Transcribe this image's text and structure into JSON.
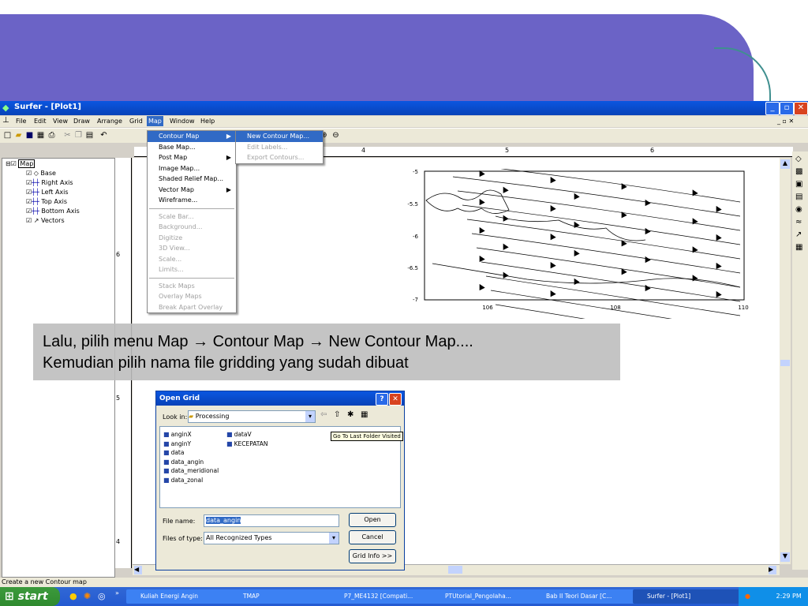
{
  "window": {
    "title": "Surfer - [Plot1]"
  },
  "menubar": [
    "File",
    "Edit",
    "View",
    "Draw",
    "Arrange",
    "Grid",
    "Map",
    "Window",
    "Help"
  ],
  "map_menu": {
    "items": [
      {
        "label": "Contour Map",
        "state": "selected",
        "submenu": true
      },
      {
        "label": "Base Map...",
        "state": "enabled"
      },
      {
        "label": "Post Map",
        "state": "enabled",
        "submenu": true
      },
      {
        "label": "Image Map...",
        "state": "enabled"
      },
      {
        "label": "Shaded Relief Map...",
        "state": "enabled"
      },
      {
        "label": "Vector Map",
        "state": "enabled",
        "submenu": true
      },
      {
        "label": "Wireframe...",
        "state": "enabled"
      },
      {
        "label": "Scale Bar...",
        "state": "disabled"
      },
      {
        "label": "Background...",
        "state": "disabled"
      },
      {
        "label": "Digitize",
        "state": "disabled"
      },
      {
        "label": "3D View...",
        "state": "disabled"
      },
      {
        "label": "Scale...",
        "state": "disabled"
      },
      {
        "label": "Limits...",
        "state": "disabled"
      },
      {
        "label": "Stack Maps",
        "state": "disabled"
      },
      {
        "label": "Overlay Maps",
        "state": "disabled"
      },
      {
        "label": "Break Apart Overlay",
        "state": "disabled"
      }
    ]
  },
  "contour_submenu": [
    "New Contour Map...",
    "Edit Labels...",
    "Export Contours..."
  ],
  "tree": {
    "root": "Map",
    "children": [
      "Base",
      "Right Axis",
      "Left Axis",
      "Top Axis",
      "Bottom Axis",
      "Vectors"
    ]
  },
  "ruler": {
    "top": [
      "4",
      "5",
      "6"
    ],
    "left": [
      "6",
      "5",
      "4"
    ]
  },
  "plot": {
    "y_ticks": [
      "-5",
      "-5.5",
      "-6",
      "-6.5",
      "-7"
    ],
    "x_ticks": [
      "106",
      "108",
      "110"
    ]
  },
  "caption": {
    "line1": "Lalu, pilih menu Map → Contour Map → New Contour Map....",
    "line2": "Kemudian pilih nama file gridding yang sudah dibuat"
  },
  "dialog": {
    "title": "Open Grid",
    "look_in_label": "Look in:",
    "look_in_value": "Processing",
    "tooltip": "Go To Last Folder Visited",
    "files_col1": [
      "anginX",
      "anginY",
      "data",
      "data_angin",
      "data_meridional",
      "data_zonal"
    ],
    "files_col2": [
      "dataV",
      "KECEPATAN"
    ],
    "file_name_label": "File name:",
    "file_name_value": "data_angin",
    "file_type_label": "Files of type:",
    "file_type_value": "All Recognized Types",
    "open_label": "Open",
    "cancel_label": "Cancel",
    "gridinfo_label": "Grid Info >>"
  },
  "status": "Create a new Contour map",
  "taskbar": {
    "start": "start",
    "tasks": [
      "Kuliah Energi Angin",
      "TMAP",
      "P7_ME4132 [Compati...",
      "PTUtorial_Pengolaha...",
      "Bab II Teori Dasar [C...",
      "Surfer - [Plot1]"
    ],
    "clock": "2:29 PM"
  }
}
